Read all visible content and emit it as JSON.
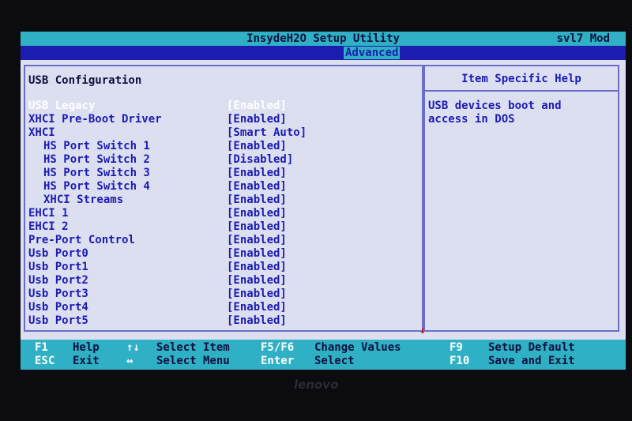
{
  "header": {
    "title": "InsydeH2O Setup Utility",
    "revision": "svl7 Mod",
    "active_tab": "Advanced"
  },
  "main": {
    "section_title": "USB Configuration",
    "items": [
      {
        "label": "USB Legacy",
        "value": "[Enabled]",
        "indent": false,
        "selected": true
      },
      {
        "label": "XHCI Pre-Boot Driver",
        "value": "[Enabled]",
        "indent": false,
        "selected": false
      },
      {
        "label": "XHCI",
        "value": "[Smart Auto]",
        "indent": false,
        "selected": false
      },
      {
        "label": "HS Port Switch 1",
        "value": "[Enabled]",
        "indent": true,
        "selected": false
      },
      {
        "label": "HS Port Switch 2",
        "value": "[Disabled]",
        "indent": true,
        "selected": false
      },
      {
        "label": "HS Port Switch 3",
        "value": "[Enabled]",
        "indent": true,
        "selected": false
      },
      {
        "label": "HS Port Switch 4",
        "value": "[Enabled]",
        "indent": true,
        "selected": false
      },
      {
        "label": "XHCI Streams",
        "value": "[Enabled]",
        "indent": true,
        "selected": false
      },
      {
        "label": "EHCI 1",
        "value": "[Enabled]",
        "indent": false,
        "selected": false
      },
      {
        "label": "EHCI 2",
        "value": "[Enabled]",
        "indent": false,
        "selected": false
      },
      {
        "label": "Pre-Port Control",
        "value": "[Enabled]",
        "indent": false,
        "selected": false
      },
      {
        "label": "Usb Port0",
        "value": "[Enabled]",
        "indent": false,
        "selected": false
      },
      {
        "label": "Usb Port1",
        "value": "[Enabled]",
        "indent": false,
        "selected": false
      },
      {
        "label": "Usb Port2",
        "value": "[Enabled]",
        "indent": false,
        "selected": false
      },
      {
        "label": "Usb Port3",
        "value": "[Enabled]",
        "indent": false,
        "selected": false
      },
      {
        "label": "Usb Port4",
        "value": "[Enabled]",
        "indent": false,
        "selected": false
      },
      {
        "label": "Usb Port5",
        "value": "[Enabled]",
        "indent": false,
        "selected": false
      }
    ],
    "scroll_indicator": "↓"
  },
  "help": {
    "title": "Item Specific Help",
    "lines": [
      "USB devices boot and",
      "access in DOS"
    ]
  },
  "footer": {
    "keys": [
      {
        "key": "F1",
        "desc": "Help"
      },
      {
        "key": "ESC",
        "desc": "Exit"
      },
      {
        "key": "↑↓",
        "desc": "Select Item"
      },
      {
        "key": "↔",
        "desc": "Select Menu"
      },
      {
        "key": "F5/F6",
        "desc": "Change Values"
      },
      {
        "key": "Enter",
        "desc": "Select"
      },
      {
        "key": "F9",
        "desc": "Setup Default"
      },
      {
        "key": "F10",
        "desc": "Save and Exit"
      }
    ]
  },
  "bezel": {
    "brand": "lenovo"
  },
  "colors": {
    "background": "#dcdff0",
    "accent_cyan": "#2fb0c4",
    "text_blue": "#1c1cb0",
    "selected_text": "#ffffff"
  }
}
